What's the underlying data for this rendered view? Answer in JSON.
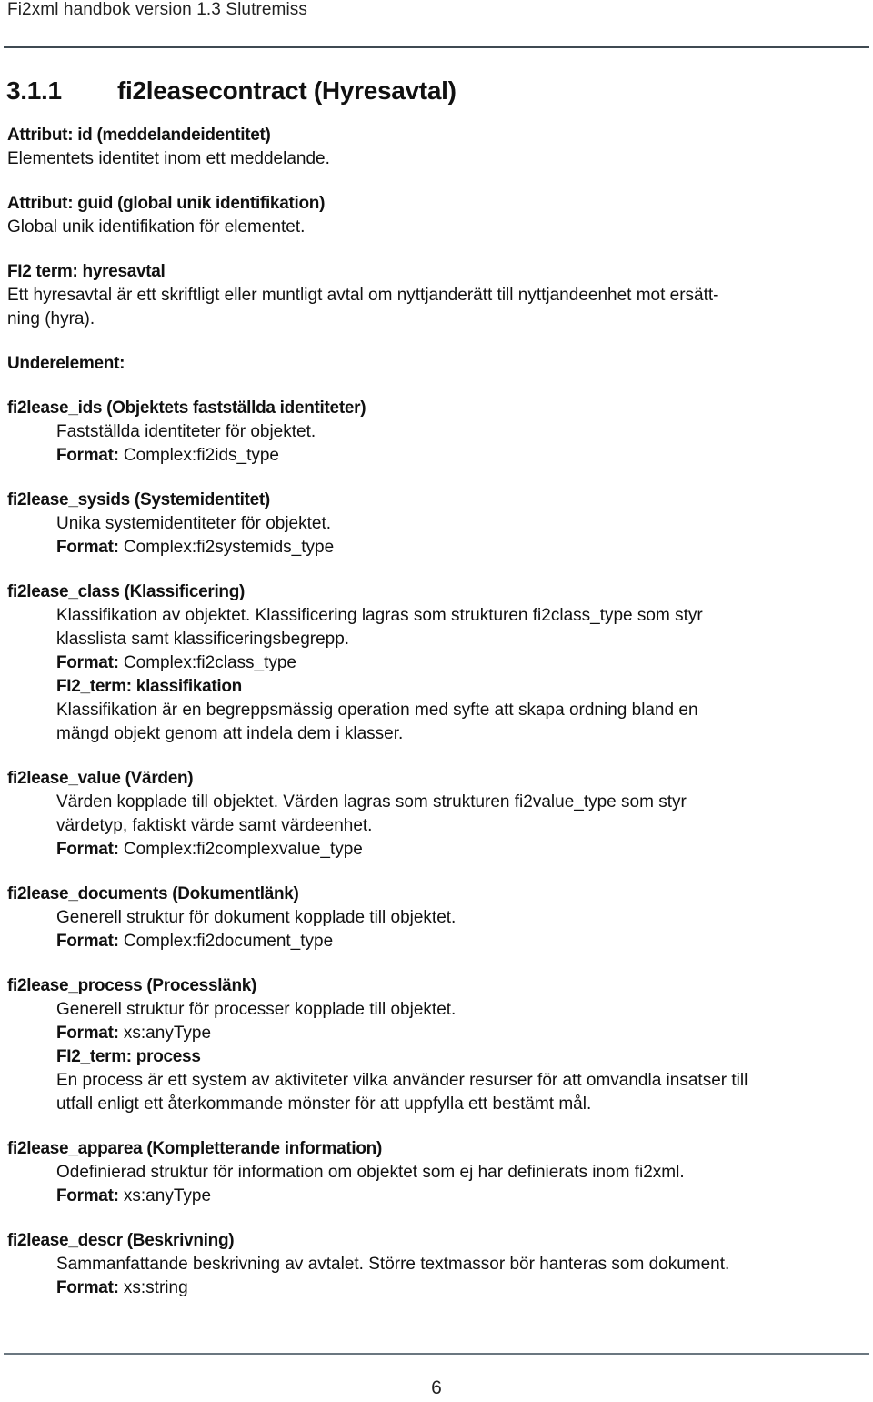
{
  "header": {
    "running_title": "Fi2xml handbok version 1.3 Slutremiss"
  },
  "section": {
    "number": "3.1.1",
    "title": "fi2leasecontract (Hyresavtal)"
  },
  "attributes": [
    {
      "heading": "Attribut: id (meddelandeidentitet)",
      "description": "Elementets identitet inom ett meddelande."
    },
    {
      "heading": "Attribut: guid (global unik identifikation)",
      "description": "Global unik identifikation för elementet."
    }
  ],
  "term": {
    "heading": "FI2 term: hyresavtal",
    "description_line1": "Ett hyresavtal är ett skriftligt eller muntligt avtal om nyttjanderätt till nyttjandeenhet mot ersätt-",
    "description_line2": "ning (hyra)."
  },
  "subelements_heading": "Underelement:",
  "format_label": "Format:",
  "subelements": [
    {
      "heading": "fi2lease_ids (Objektets fastställda identiteter)",
      "description": [
        "Fastställda identiteter för objektet."
      ],
      "format": "Complex:fi2ids_type"
    },
    {
      "heading": "fi2lease_sysids (Systemidentitet)",
      "description": [
        "Unika systemidentiteter för objektet."
      ],
      "format": "Complex:fi2systemids_type"
    },
    {
      "heading": "fi2lease_class (Klassificering)",
      "description": [
        "Klassifikation av objektet. Klassificering lagras som strukturen fi2class_type som styr",
        "klasslista samt klassificeringsbegrepp."
      ],
      "format": "Complex:fi2class_type",
      "term_heading": "FI2_term: klassifikation",
      "term_description": [
        "Klassifikation är en begreppsmässig operation med syfte att skapa ordning bland en",
        "mängd objekt genom att indela dem i klasser."
      ]
    },
    {
      "heading": "fi2lease_value (Värden)",
      "description": [
        "Värden kopplade till objektet. Värden lagras som strukturen fi2value_type som styr",
        "värdetyp, faktiskt värde samt värdeenhet."
      ],
      "format": "Complex:fi2complexvalue_type"
    },
    {
      "heading": "fi2lease_documents (Dokumentlänk)",
      "description": [
        "Generell struktur för dokument kopplade till objektet."
      ],
      "format": "Complex:fi2document_type"
    },
    {
      "heading": "fi2lease_process (Processlänk)",
      "description": [
        "Generell struktur för processer kopplade till objektet."
      ],
      "format": "xs:anyType",
      "term_heading": "FI2_term: process",
      "term_description": [
        "En process är ett system av aktiviteter vilka använder resurser för att omvandla insatser till",
        "utfall enligt ett återkommande mönster för att uppfylla ett bestämt mål."
      ]
    },
    {
      "heading": "fi2lease_apparea (Kompletterande information)",
      "description": [
        "Odefinierad struktur för information om objektet som ej har definierats inom fi2xml."
      ],
      "format": "xs:anyType"
    },
    {
      "heading": "fi2lease_descr (Beskrivning)",
      "description": [
        "Sammanfattande beskrivning av avtalet. Större textmassor bör hanteras som dokument."
      ],
      "format": "xs:string"
    }
  ],
  "footer": {
    "page_number": "6"
  }
}
